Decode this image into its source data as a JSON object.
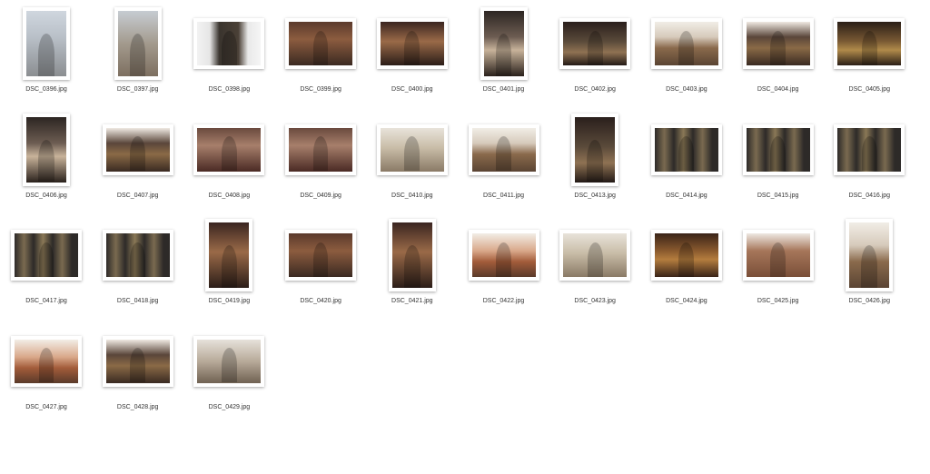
{
  "files": [
    {
      "name": "DSC_0396.jpg",
      "orientation": "portrait",
      "tone": "t-facade"
    },
    {
      "name": "DSC_0397.jpg",
      "orientation": "portrait",
      "tone": "t-crucifix"
    },
    {
      "name": "DSC_0398.jpg",
      "orientation": "landscape",
      "tone": "t-door"
    },
    {
      "name": "DSC_0399.jpg",
      "orientation": "landscape",
      "tone": "t-nave"
    },
    {
      "name": "DSC_0400.jpg",
      "orientation": "landscape",
      "tone": "t-aisle"
    },
    {
      "name": "DSC_0401.jpg",
      "orientation": "portrait",
      "tone": "t-tall"
    },
    {
      "name": "DSC_0402.jpg",
      "orientation": "landscape",
      "tone": "t-windows"
    },
    {
      "name": "DSC_0403.jpg",
      "orientation": "landscape",
      "tone": "t-pulpit"
    },
    {
      "name": "DSC_0404.jpg",
      "orientation": "landscape",
      "tone": "t-organ"
    },
    {
      "name": "DSC_0405.jpg",
      "orientation": "landscape",
      "tone": "t-gold"
    },
    {
      "name": "DSC_0406.jpg",
      "orientation": "portrait",
      "tone": "t-tall"
    },
    {
      "name": "DSC_0407.jpg",
      "orientation": "landscape",
      "tone": "t-organ"
    },
    {
      "name": "DSC_0408.jpg",
      "orientation": "landscape",
      "tone": "t-pews"
    },
    {
      "name": "DSC_0409.jpg",
      "orientation": "landscape",
      "tone": "t-pews"
    },
    {
      "name": "DSC_0410.jpg",
      "orientation": "landscape",
      "tone": "t-vault"
    },
    {
      "name": "DSC_0411.jpg",
      "orientation": "landscape",
      "tone": "t-pulpit"
    },
    {
      "name": "DSC_0413.jpg",
      "orientation": "portrait",
      "tone": "t-windows"
    },
    {
      "name": "DSC_0414.jpg",
      "orientation": "landscape",
      "tone": "t-glass"
    },
    {
      "name": "DSC_0415.jpg",
      "orientation": "landscape",
      "tone": "t-glass"
    },
    {
      "name": "DSC_0416.jpg",
      "orientation": "landscape",
      "tone": "t-glass"
    },
    {
      "name": "DSC_0417.jpg",
      "orientation": "landscape",
      "tone": "t-glass"
    },
    {
      "name": "DSC_0418.jpg",
      "orientation": "landscape",
      "tone": "t-glass"
    },
    {
      "name": "DSC_0419.jpg",
      "orientation": "portrait",
      "tone": "t-aisle"
    },
    {
      "name": "DSC_0420.jpg",
      "orientation": "landscape",
      "tone": "t-nave"
    },
    {
      "name": "DSC_0421.jpg",
      "orientation": "portrait",
      "tone": "t-aisle"
    },
    {
      "name": "DSC_0422.jpg",
      "orientation": "landscape",
      "tone": "t-arches"
    },
    {
      "name": "DSC_0423.jpg",
      "orientation": "landscape",
      "tone": "t-vault"
    },
    {
      "name": "DSC_0424.jpg",
      "orientation": "landscape",
      "tone": "t-altar"
    },
    {
      "name": "DSC_0425.jpg",
      "orientation": "landscape",
      "tone": "t-benches"
    },
    {
      "name": "DSC_0426.jpg",
      "orientation": "portrait",
      "tone": "t-pulpit"
    },
    {
      "name": "DSC_0427.jpg",
      "orientation": "landscape",
      "tone": "t-arches"
    },
    {
      "name": "DSC_0428.jpg",
      "orientation": "landscape",
      "tone": "t-organ"
    },
    {
      "name": "DSC_0429.jpg",
      "orientation": "landscape",
      "tone": "t-wall"
    }
  ]
}
